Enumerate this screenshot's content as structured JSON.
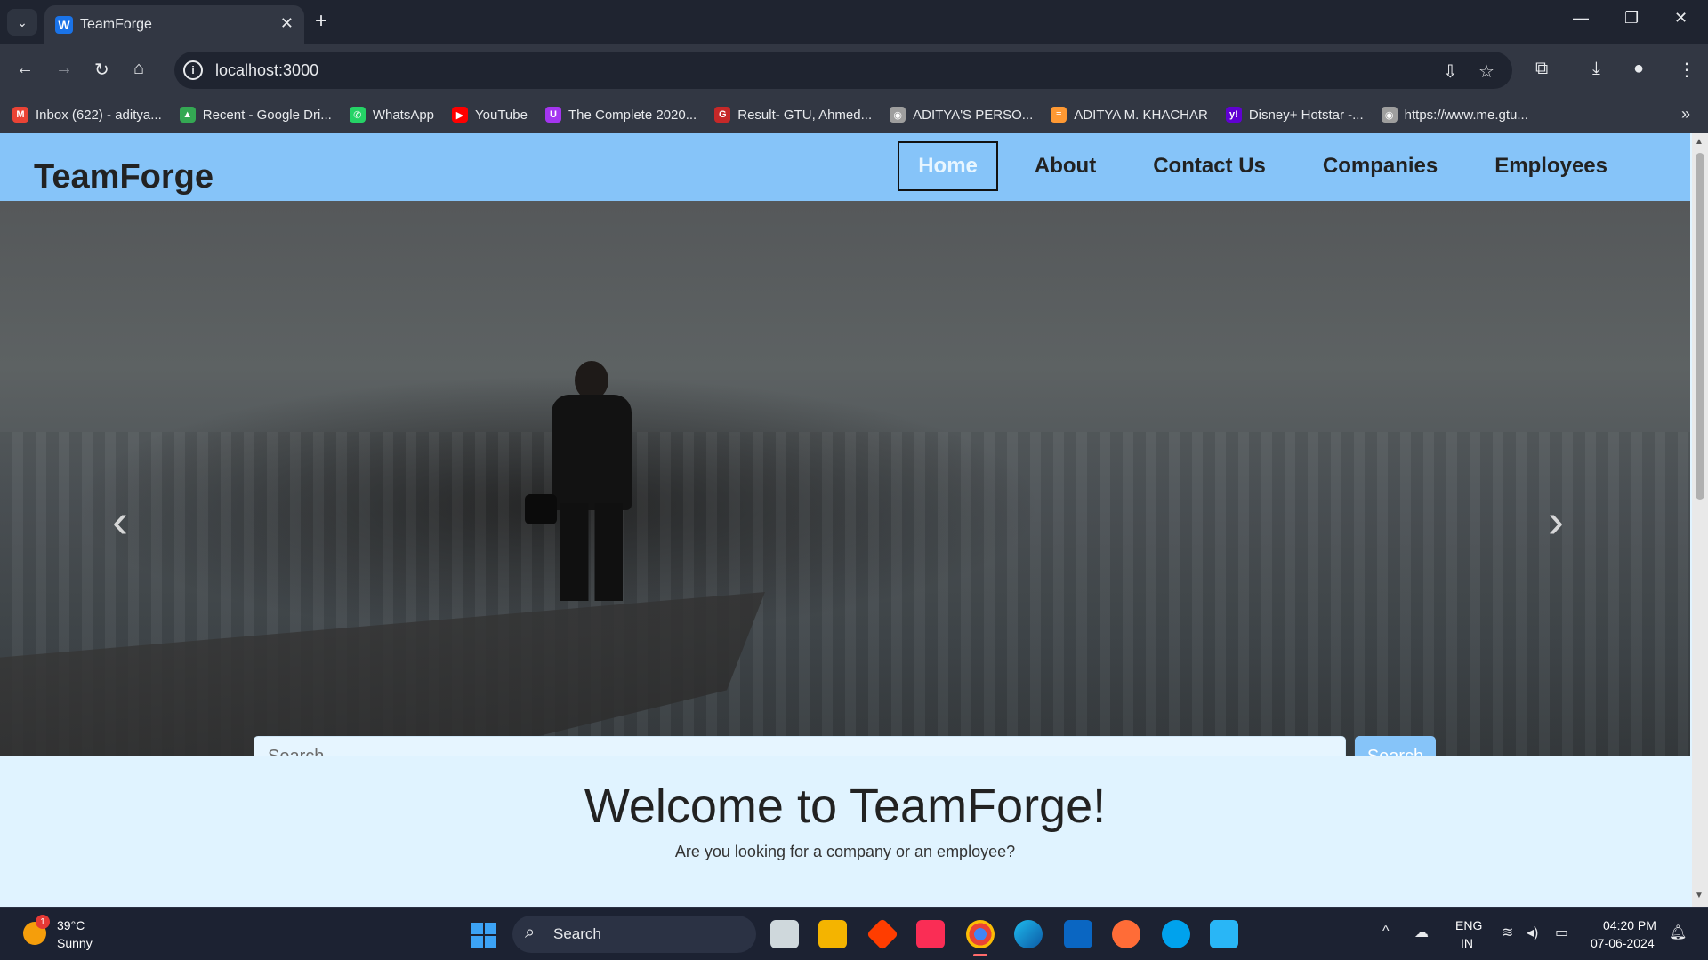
{
  "browser": {
    "tab_title": "TeamForge",
    "tab_favicon_letter": "W",
    "url": "localhost:3000",
    "bookmarks": [
      {
        "label": "Inbox (622) - aditya...",
        "icon": "gmail-icon",
        "color": "#ea4335",
        "glyph": "M"
      },
      {
        "label": "Recent - Google Dri...",
        "icon": "google-drive-icon",
        "color": "#34a853",
        "glyph": "▲"
      },
      {
        "label": "WhatsApp",
        "icon": "whatsapp-icon",
        "color": "#25d366",
        "glyph": "✆"
      },
      {
        "label": "YouTube",
        "icon": "youtube-icon",
        "color": "#ff0000",
        "glyph": "▶"
      },
      {
        "label": "The Complete 2020...",
        "icon": "udemy-icon",
        "color": "#a435f0",
        "glyph": "U"
      },
      {
        "label": "Result- GTU, Ahmed...",
        "icon": "gtu-icon",
        "color": "#c62828",
        "glyph": "G"
      },
      {
        "label": "ADITYA'S PERSO...",
        "icon": "globe-icon",
        "color": "#9e9e9e",
        "glyph": "◉"
      },
      {
        "label": "ADITYA M. KHACHAR",
        "icon": "india-flag-icon",
        "color": "#ff9933",
        "glyph": "≡"
      },
      {
        "label": "Disney+ Hotstar -...",
        "icon": "yahoo-icon",
        "color": "#6001d2",
        "glyph": "y!"
      },
      {
        "label": "https://www.me.gtu...",
        "icon": "globe-icon",
        "color": "#9e9e9e",
        "glyph": "◉"
      }
    ]
  },
  "site": {
    "brand": "TeamForge",
    "nav": [
      {
        "label": "Home",
        "active": true
      },
      {
        "label": "About",
        "active": false
      },
      {
        "label": "Contact Us",
        "active": false
      },
      {
        "label": "Companies",
        "active": false
      },
      {
        "label": "Employees",
        "active": false
      }
    ],
    "search": {
      "placeholder": "Search",
      "button_label": "Search"
    },
    "welcome": {
      "title": "Welcome to TeamForge!",
      "subtitle": "Are you looking for a company or an employee?"
    },
    "colors": {
      "navbar": "#86c4f9",
      "page_bg": "#e0f3ff",
      "search_button": "#86c4f9"
    }
  },
  "taskbar": {
    "weather_temp": "39°C",
    "weather_desc": "Sunny",
    "weather_badge": "1",
    "search_label": "Search",
    "lang_1": "ENG",
    "lang_2": "IN",
    "time": "04:20 PM",
    "date": "07-06-2024"
  }
}
